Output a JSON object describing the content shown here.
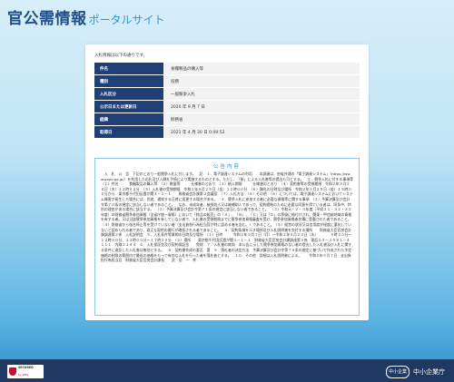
{
  "header": {
    "title_main": "官公需情報",
    "title_sub": "ポータルサイト"
  },
  "intro": "入札情報は以下の通りです。",
  "info_rows": [
    {
      "label": "件名",
      "value": "食糧製品の購入等"
    },
    {
      "label": "種別",
      "value": "役務"
    },
    {
      "label": "入札区分",
      "value": "一般競争入札"
    },
    {
      "label": "公示日または更新日",
      "value": "2020 年 9 月 7 日"
    },
    {
      "label": "組織",
      "value": "財務省"
    },
    {
      "label": "取得日",
      "value": "2021 年 4 月 30 日 0:09:52"
    }
  ],
  "notice": {
    "title": "公告内容",
    "body": "　入　札　公　告　下記のとおり一般競争入札に付します。　記　１．電子調達システムの利用　　本調達は、府省共通の「電子調達システム」（https://www.geps.go.jp/）を利用した応札及び入開札手続により実施するものとする。ただし、「紙」による入札書等の提出も可とする。　２．競争入札に付する事項等　（１）件名　　　食糧製品の購入等　（２）数量等　　　仕様書のとおり　（３）納入期限　　　仕様書のとおり　（４）契約書等の受領期限　令和２年９月２４日（木）１２時００分　（５）入札書の受領期限　令和２年９月２５日（金）１２時００分　（６）開札の日時及び場所　令和２年９月２５日（金）１５時００分から　東京都千代田区霞が関３－１－１　　財務省会計課第２会議室　（７）入札方法　（８）その他　（６）については、電子調達システムにおいてシステム障害が発生した場合には、別途、通知する日時に変更する場合がある。　３．競争入札に参加する者に必要な資格等に関する事項　（１）予算決算及び会計令第７０条の規定に該当しない者であること。　なお、未成年者、被保佐人又は被補助人であって、契約締結のために必要な同意を得ている者は、同条中、特別の理由がある場合に該当する。　（２）予算決算及び会計令第７１条の規定に該当しない者であること。　（３）令和元・２・３年度（平成３１・３２・３３年度）の財務省競争参加資格（全省庁統一資格）において「物品の販売」の「Ａ」、「Ｂ」、「Ｃ」又は「Ｄ」の等級に格付けされ、関東・甲信越地域の資格を有する者。又は当該競争参加資格を有していない者で、入札書の受領期限までに競争参加資格審査を受け、競争参加資格者名簿に登載された者であること。（４）財務省から指名停止等を受けていない者（支出負担行為担当官が特に認める者を含む。）であること。（５）経営の状況又は信用度が極度に悪化していないと認められる者であり、適正な契約の履行が確保される者であること。　４．契約条項を示す場所及び入札説明書を交付する場所　　財務省大臣官房会計課調達第３係　入札説明会　５．入札条件等質問の日時及び場所　（１）日時　　　令和２年９月７日（月）～令和２年９月２３日（水）　　　　９時３０分～１２時００分、１３時００分～１７時３０分　（２）場所　　東京都千代田区霞が関３－１－１　財務省大臣官房会計課調達第３係　電話０３－３５８１－４１１１　内線２１４４　６．入札保証金及び契約保証金　　免除　７．入札書の無効　本公告に示した競争参加資格のない者の提出した入札書及び入札に関する条件に違反した入札書は無効とする。　８．契約書作成の要否　要　９．落札者の決定方法　予算決算及び会計令第７９条の規定に基づいて作成された予定価格の制限の範囲内で最低の価格をもって有効な入札を行った者を落札者とする。　１０．その他　詳細は入札説明書による。　　令和２年９月７日　支出負担行為担当官　財務省大臣官房会計課長　　武　田　一　孝"
  },
  "footer": {
    "secured_label": "SECURED",
    "secured_by": "by JPRS",
    "sme_mark": "中小企業",
    "sme_name": "中小企業庁"
  },
  "colors": {
    "header_text": "#1e4f8a",
    "accent": "#2a96d2",
    "table_header": "#1f3f77",
    "footer_bg": "#1f3963"
  }
}
